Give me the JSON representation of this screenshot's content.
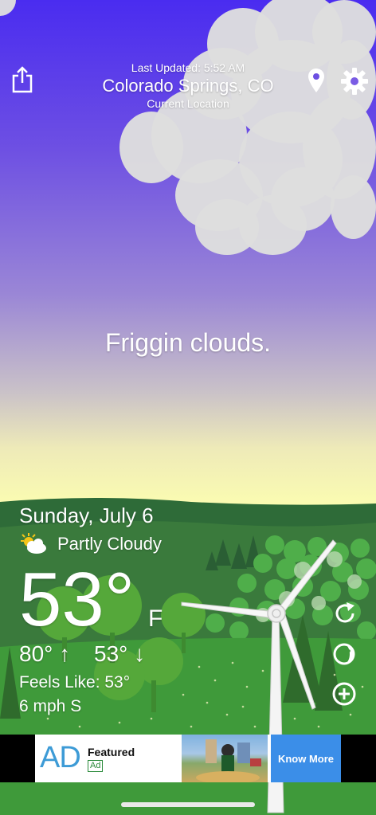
{
  "header": {
    "last_updated": "Last Updated: 5:52 AM",
    "location": "Colorado Springs, CO",
    "location_sub": "Current Location"
  },
  "message": "Friggin clouds.",
  "weather": {
    "date": "Sunday, July 6",
    "condition": "Partly Cloudy",
    "temperature": "53°",
    "unit": "F",
    "high": "80°",
    "low": "53°",
    "feels_like": "Feels Like: 53°",
    "wind": "6 mph S"
  },
  "icons": {
    "share": "share-icon",
    "location": "location-pin-icon",
    "settings": "gear-icon",
    "refresh": "refresh-icon",
    "moon": "moon-phase-icon",
    "add": "plus-circle-icon",
    "condition": "partly-cloudy-icon"
  },
  "ad": {
    "logo": "AD",
    "title": "Featured",
    "tag": "Ad",
    "button": "Know More"
  },
  "colors": {
    "sky_top": "#4a2cf0",
    "sky_horizon": "#fbfcb1",
    "grass": "#3f9a3a",
    "ad_button": "#3b8ee8"
  }
}
